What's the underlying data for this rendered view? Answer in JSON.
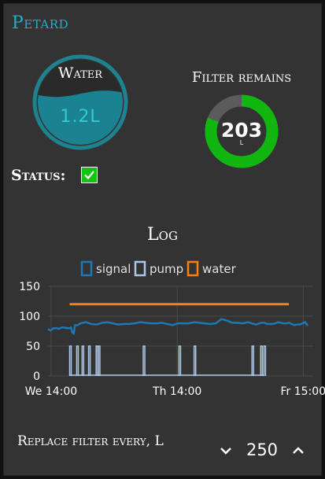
{
  "card": {
    "title": "Petard"
  },
  "water": {
    "label": "Water",
    "value": "1.2L",
    "fill_fraction": 0.6
  },
  "filter": {
    "label": "Filter remains",
    "value": "203",
    "unit": "L",
    "total": 250,
    "remaining_fraction": 0.81
  },
  "status": {
    "label": "Status:",
    "checked": true
  },
  "log": {
    "title": "Log"
  },
  "chart_data": {
    "type": "line",
    "title": "",
    "xlabel": "",
    "ylabel": "",
    "ylim": [
      0,
      150
    ],
    "yticks": [
      0,
      50,
      100,
      150
    ],
    "xticks": [
      "We 14:00",
      "Th 14:00",
      "Fr 15:00"
    ],
    "legend": {
      "position": "top",
      "entries": [
        "signal",
        "pump",
        "water"
      ]
    },
    "grid": true,
    "x_range_hours": [
      0,
      49
    ],
    "series": [
      {
        "name": "signal",
        "color": "#1f77b4",
        "x": [
          0,
          1,
          2,
          3,
          4,
          4.5,
          5,
          6,
          8,
          10,
          12,
          14,
          16,
          18,
          20,
          22,
          24,
          26,
          28,
          30,
          32,
          34,
          36,
          38,
          39,
          40,
          41,
          42,
          43,
          44,
          45,
          46,
          47,
          48
        ],
        "y": [
          78,
          80,
          79,
          81,
          80,
          73,
          85,
          88,
          87,
          89,
          88,
          87,
          88,
          89,
          88,
          87,
          88,
          88,
          89,
          87,
          95,
          89,
          88,
          87,
          88,
          89,
          87,
          88,
          89,
          88,
          87,
          86,
          88,
          84
        ]
      },
      {
        "name": "pump",
        "color": "#aec7e8",
        "pulses_x": [
          4,
          5.3,
          6.3,
          7.5,
          8.9,
          9.3,
          17.6,
          24.2,
          27,
          37.7,
          39.3,
          39.9
        ],
        "pulse_high": 50
      },
      {
        "name": "water",
        "color": "#ff7f0e",
        "x": [
          4,
          44.5
        ],
        "y": [
          120,
          120
        ]
      }
    ]
  },
  "footer": {
    "label": "Replace filter every, L",
    "value": "250"
  },
  "colors": {
    "accent": "#1fb2c4",
    "donut_green": "#11b611",
    "donut_grey": "#5b5b5b",
    "water_fill": "#1a8290"
  }
}
